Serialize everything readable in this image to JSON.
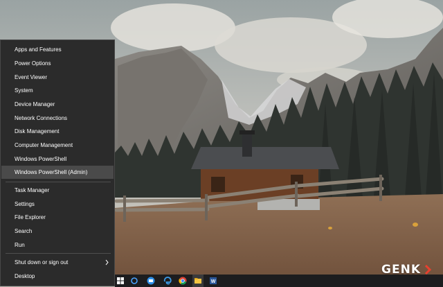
{
  "menu": {
    "groups": [
      [
        "Apps and Features",
        "Power Options",
        "Event Viewer",
        "System",
        "Device Manager",
        "Network Connections",
        "Disk Management",
        "Computer Management",
        "Windows PowerShell",
        "Windows PowerShell (Admin)"
      ],
      [
        "Task Manager",
        "Settings",
        "File Explorer",
        "Search",
        "Run"
      ],
      [
        "Shut down or sign out",
        "Desktop"
      ]
    ],
    "highlighted_item": "Windows PowerShell (Admin)",
    "submenu_item": "Shut down or sign out"
  },
  "taskbar": {
    "icons": [
      "windows-start-icon",
      "search-icon",
      "cortana-icon",
      "task-view-icon",
      "edge-icon",
      "chrome-icon",
      "file-explorer-icon",
      "word-icon"
    ]
  },
  "watermark": {
    "text": "GENK"
  },
  "colors": {
    "menu_bg": "#2b2b2b",
    "menu_highlight": "#4a4a4a",
    "menu_text": "#ffffff",
    "taskbar_bg": "#1d1d1f"
  }
}
